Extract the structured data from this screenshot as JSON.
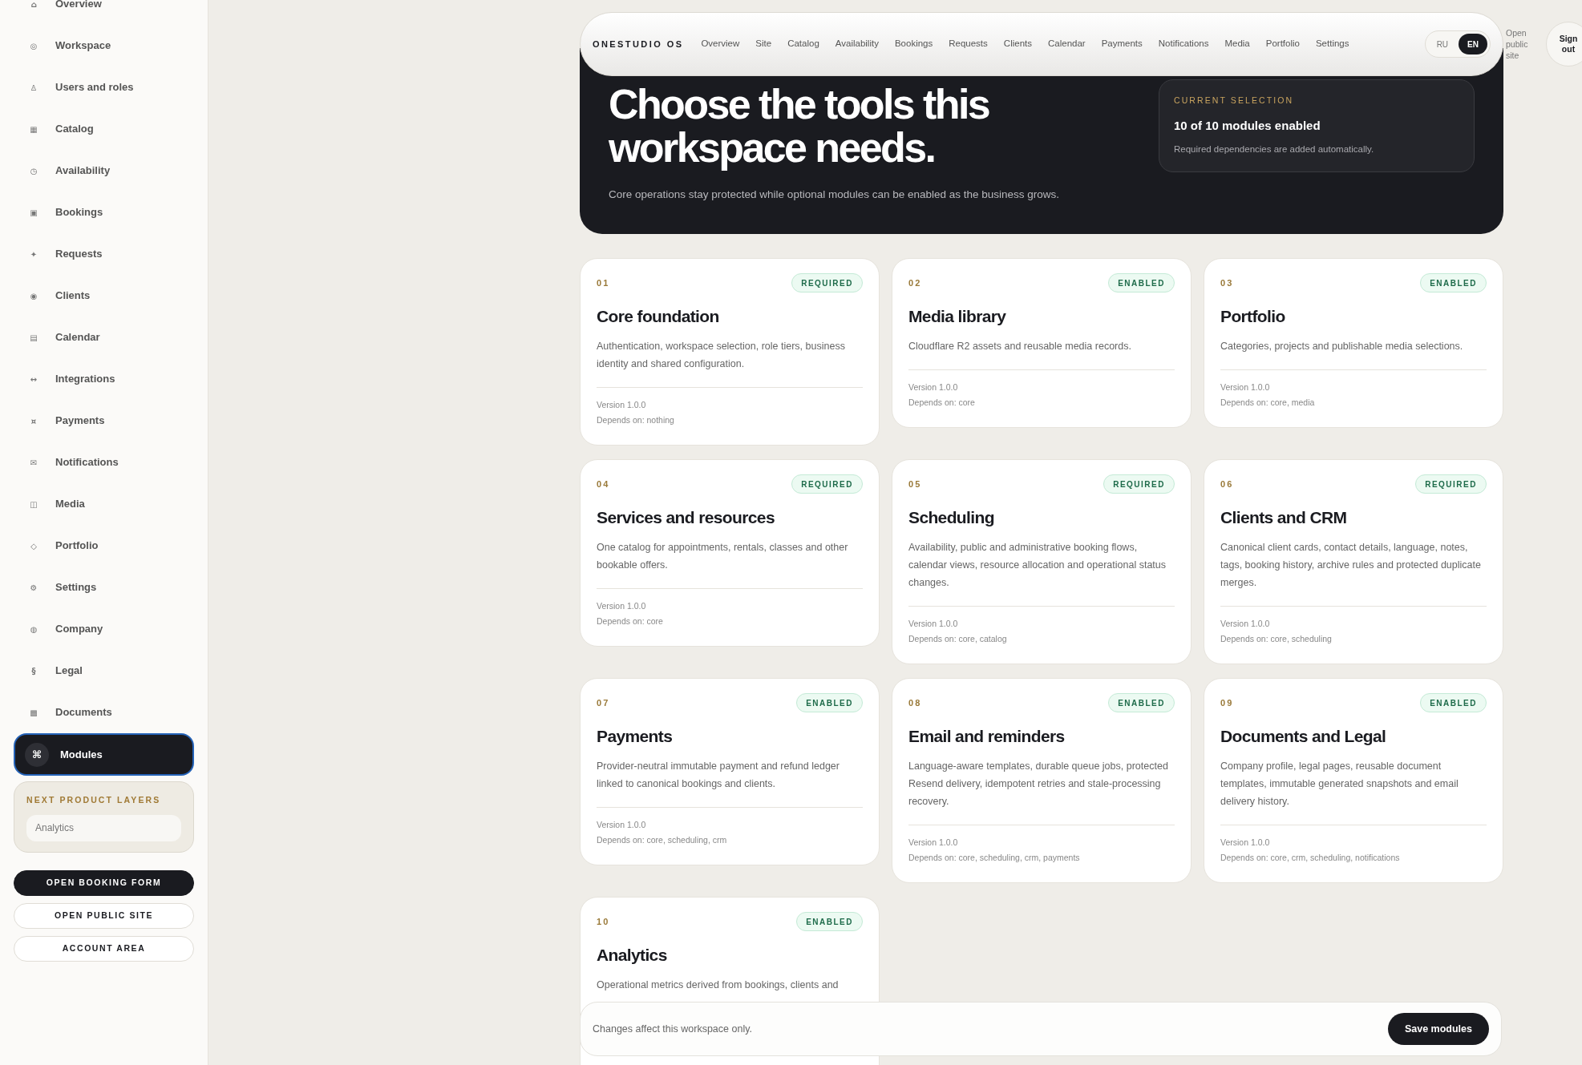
{
  "sidebar": {
    "items": [
      {
        "icon": "⌂",
        "label": "Overview",
        "selected": false
      },
      {
        "icon": "◎",
        "label": "Workspace",
        "selected": false
      },
      {
        "icon": "♙",
        "label": "Users and roles",
        "selected": false
      },
      {
        "icon": "▦",
        "label": "Catalog",
        "selected": false
      },
      {
        "icon": "◷",
        "label": "Availability",
        "selected": false
      },
      {
        "icon": "▣",
        "label": "Bookings",
        "selected": false
      },
      {
        "icon": "✦",
        "label": "Requests",
        "selected": false
      },
      {
        "icon": "◉",
        "label": "Clients",
        "selected": false
      },
      {
        "icon": "▤",
        "label": "Calendar",
        "selected": false
      },
      {
        "icon": "↔",
        "label": "Integrations",
        "selected": false
      },
      {
        "icon": "¤",
        "label": "Payments",
        "selected": false
      },
      {
        "icon": "✉",
        "label": "Notifications",
        "selected": false
      },
      {
        "icon": "◫",
        "label": "Media",
        "selected": false
      },
      {
        "icon": "◇",
        "label": "Portfolio",
        "selected": false
      },
      {
        "icon": "⚙",
        "label": "Settings",
        "selected": false
      },
      {
        "icon": "◍",
        "label": "Company",
        "selected": false
      },
      {
        "icon": "§",
        "label": "Legal",
        "selected": false
      },
      {
        "icon": "▩",
        "label": "Documents",
        "selected": false
      },
      {
        "icon": "⌘",
        "label": "Modules",
        "selected": true
      }
    ],
    "next_layers": {
      "title": "NEXT PRODUCT LAYERS",
      "items": [
        "Analytics"
      ]
    },
    "buttons": [
      {
        "label": "OPEN BOOKING FORM",
        "kind": "primary"
      },
      {
        "label": "OPEN PUBLIC SITE",
        "kind": "outline"
      },
      {
        "label": "ACCOUNT AREA",
        "kind": "outline"
      }
    ]
  },
  "header": {
    "brand": "ONESTUDIO OS",
    "nav": [
      "Overview",
      "Site",
      "Catalog",
      "Availability",
      "Bookings",
      "Requests",
      "Clients",
      "Calendar",
      "Payments",
      "Notifications",
      "Media",
      "Portfolio",
      "Settings"
    ],
    "languages": [
      {
        "label": "RU",
        "selected": false
      },
      {
        "label": "EN",
        "selected": true
      }
    ],
    "open_site": "Open public site",
    "sign_out": "Sign out"
  },
  "hero": {
    "title": "Choose the tools this workspace needs.",
    "subtitle": "Core operations stay protected while optional modules can be enabled as the business grows.",
    "selection": {
      "label": "CURRENT SELECTION",
      "value": "10 of 10 modules enabled",
      "note": "Required dependencies are added automatically."
    }
  },
  "modules": [
    {
      "number": "01",
      "badge": "REQUIRED",
      "title": "Core foundation",
      "description": "Authentication, workspace selection, role tiers, business identity and shared configuration.",
      "version": "Version 1.0.0",
      "depends": "Depends on: nothing"
    },
    {
      "number": "02",
      "badge": "ENABLED",
      "title": "Media library",
      "description": "Cloudflare R2 assets and reusable media records.",
      "version": "Version 1.0.0",
      "depends": "Depends on: core"
    },
    {
      "number": "03",
      "badge": "ENABLED",
      "title": "Portfolio",
      "description": "Categories, projects and publishable media selections.",
      "version": "Version 1.0.0",
      "depends": "Depends on: core, media"
    },
    {
      "number": "04",
      "badge": "REQUIRED",
      "title": "Services and resources",
      "description": "One catalog for appointments, rentals, classes and other bookable offers.",
      "version": "Version 1.0.0",
      "depends": "Depends on: core"
    },
    {
      "number": "05",
      "badge": "REQUIRED",
      "title": "Scheduling",
      "description": "Availability, public and administrative booking flows, calendar views, resource allocation and operational status changes.",
      "version": "Version 1.0.0",
      "depends": "Depends on: core, catalog"
    },
    {
      "number": "06",
      "badge": "REQUIRED",
      "title": "Clients and CRM",
      "description": "Canonical client cards, contact details, language, notes, tags, booking history, archive rules and protected duplicate merges.",
      "version": "Version 1.0.0",
      "depends": "Depends on: core, scheduling"
    },
    {
      "number": "07",
      "badge": "ENABLED",
      "title": "Payments",
      "description": "Provider-neutral immutable payment and refund ledger linked to canonical bookings and clients.",
      "version": "Version 1.0.0",
      "depends": "Depends on: core, scheduling, crm"
    },
    {
      "number": "08",
      "badge": "ENABLED",
      "title": "Email and reminders",
      "description": "Language-aware templates, durable queue jobs, protected Resend delivery, idempotent retries and stale-processing recovery.",
      "version": "Version 1.0.0",
      "depends": "Depends on: core, scheduling, crm, payments"
    },
    {
      "number": "09",
      "badge": "ENABLED",
      "title": "Documents and Legal",
      "description": "Company profile, legal pages, reusable document templates, immutable generated snapshots and email delivery history.",
      "version": "Version 1.0.0",
      "depends": "Depends on: core, crm, scheduling, notifications"
    },
    {
      "number": "10",
      "badge": "ENABLED",
      "title": "Analytics",
      "description": "Operational metrics derived from bookings, clients and"
    }
  ],
  "save_bar": {
    "note": "Changes affect this workspace only.",
    "button": "Save modules"
  }
}
